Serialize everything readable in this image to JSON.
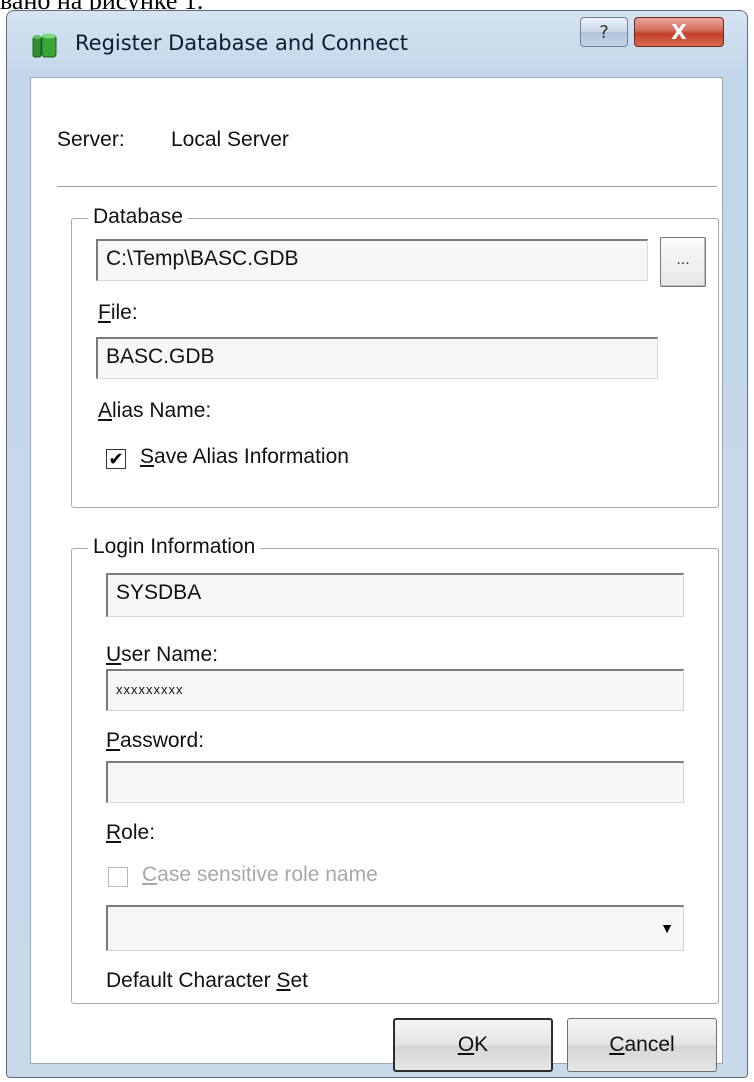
{
  "page_text": "вано на рисунке 1.",
  "window": {
    "title": "Register Database and Connect",
    "help_label": "?",
    "close_label": "X"
  },
  "server": {
    "label": "Server:",
    "value": "Local Server"
  },
  "database_group": {
    "title": "Database",
    "path_value": "C:\\Temp\\BASC.GDB",
    "browse_label": "...",
    "file_label_prefix": "",
    "file_label_accel": "F",
    "file_label_rest": "ile:",
    "file_value": "BASC.GDB",
    "alias_label_accel": "A",
    "alias_label_rest": "lias Name:",
    "save_alias_checked": true,
    "save_alias_accel": "S",
    "save_alias_rest": "ave Alias Information",
    "check_mark": "✔"
  },
  "login_group": {
    "title": "Login Information",
    "username_value": "SYSDBA",
    "username_label_accel": "U",
    "username_label_rest": "ser Name:",
    "password_value": "xxxxxxxxx",
    "password_label_accel": "P",
    "password_label_rest": "assword:",
    "role_value": "",
    "role_label_accel": "R",
    "role_label_rest": "ole:",
    "case_sensitive_checked": false,
    "case_sensitive_accel": "C",
    "case_sensitive_rest": "ase sensitive role name",
    "charset_value": "",
    "charset_label_before": "Default Character  ",
    "charset_label_accel": "S",
    "charset_label_rest": "et",
    "dropdown_arrow": "▼"
  },
  "buttons": {
    "ok_accel": "O",
    "ok_rest": "K",
    "cancel_accel": "C",
    "cancel_rest": "ancel"
  }
}
